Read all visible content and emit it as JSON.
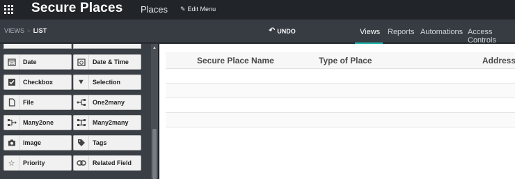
{
  "topbar": {
    "app_title": "Secure Places",
    "menu_places": "Places",
    "menu_edit": "Edit Menu"
  },
  "subbar": {
    "breadcrumb_views": "VIEWS",
    "breadcrumb_sep": ">",
    "breadcrumb_list": "LIST",
    "undo_label": "UNDO",
    "tabs": [
      "Views",
      "Reports",
      "Automations",
      "Access Controls"
    ],
    "active_tab": "Views",
    "accent_color": "#1fb5ad"
  },
  "sidebar": {
    "fields": [
      {
        "label": "Date",
        "icon": "calendar-icon"
      },
      {
        "label": "Date & Time",
        "icon": "calendar-clock-icon"
      },
      {
        "label": "Checkbox",
        "icon": "checkbox-icon"
      },
      {
        "label": "Selection",
        "icon": "caret-down-icon"
      },
      {
        "label": "File",
        "icon": "file-icon"
      },
      {
        "label": "One2many",
        "icon": "one2many-icon"
      },
      {
        "label": "Many2one",
        "icon": "many2one-icon"
      },
      {
        "label": "Many2many",
        "icon": "many2many-icon"
      },
      {
        "label": "Image",
        "icon": "camera-icon"
      },
      {
        "label": "Tags",
        "icon": "tag-icon"
      },
      {
        "label": "Priority",
        "icon": "star-icon"
      },
      {
        "label": "Related Field",
        "icon": "link-icon"
      }
    ]
  },
  "table": {
    "columns": [
      "Secure Place Name",
      "Type of Place",
      "Address"
    ],
    "rows": []
  }
}
